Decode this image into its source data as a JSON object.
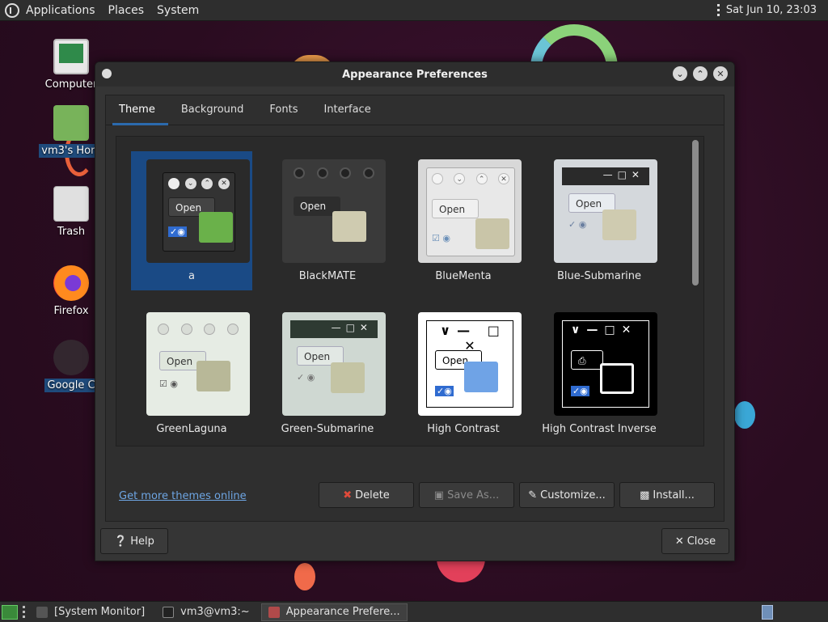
{
  "top_panel": {
    "menus": [
      "Applications",
      "Places",
      "System"
    ],
    "clock": "Sat Jun 10, 23:03"
  },
  "desktop": {
    "icons": [
      {
        "label": "Computer"
      },
      {
        "label": "vm3's Hom"
      },
      {
        "label": "Trash"
      },
      {
        "label": "Firefox"
      },
      {
        "label": "Google C"
      }
    ]
  },
  "dialog": {
    "title": "Appearance Preferences",
    "tabs": [
      "Theme",
      "Background",
      "Fonts",
      "Interface"
    ],
    "active_tab": "Theme",
    "themes": [
      {
        "name": "a",
        "selected": true
      },
      {
        "name": "BlackMATE"
      },
      {
        "name": "BlueMenta"
      },
      {
        "name": "Blue-Submarine"
      },
      {
        "name": "GreenLaguna"
      },
      {
        "name": "Green-Submarine"
      },
      {
        "name": "High Contrast"
      },
      {
        "name": "High Contrast Inverse"
      }
    ],
    "open_label": "Open",
    "buttons": {
      "delete": "Delete",
      "save_as": "Save As...",
      "customize": "Customize...",
      "install": "Install..."
    },
    "link": "Get more themes online",
    "help": "Help",
    "close": "Close"
  },
  "taskbar": {
    "tasks": [
      "[System Monitor]",
      "vm3@vm3:~",
      "Appearance Prefere..."
    ],
    "active_task": "Appearance Prefere..."
  },
  "colors": {
    "selection": "#1a4a85",
    "link": "#6ea6e4",
    "panel": "#2e2e2e"
  }
}
